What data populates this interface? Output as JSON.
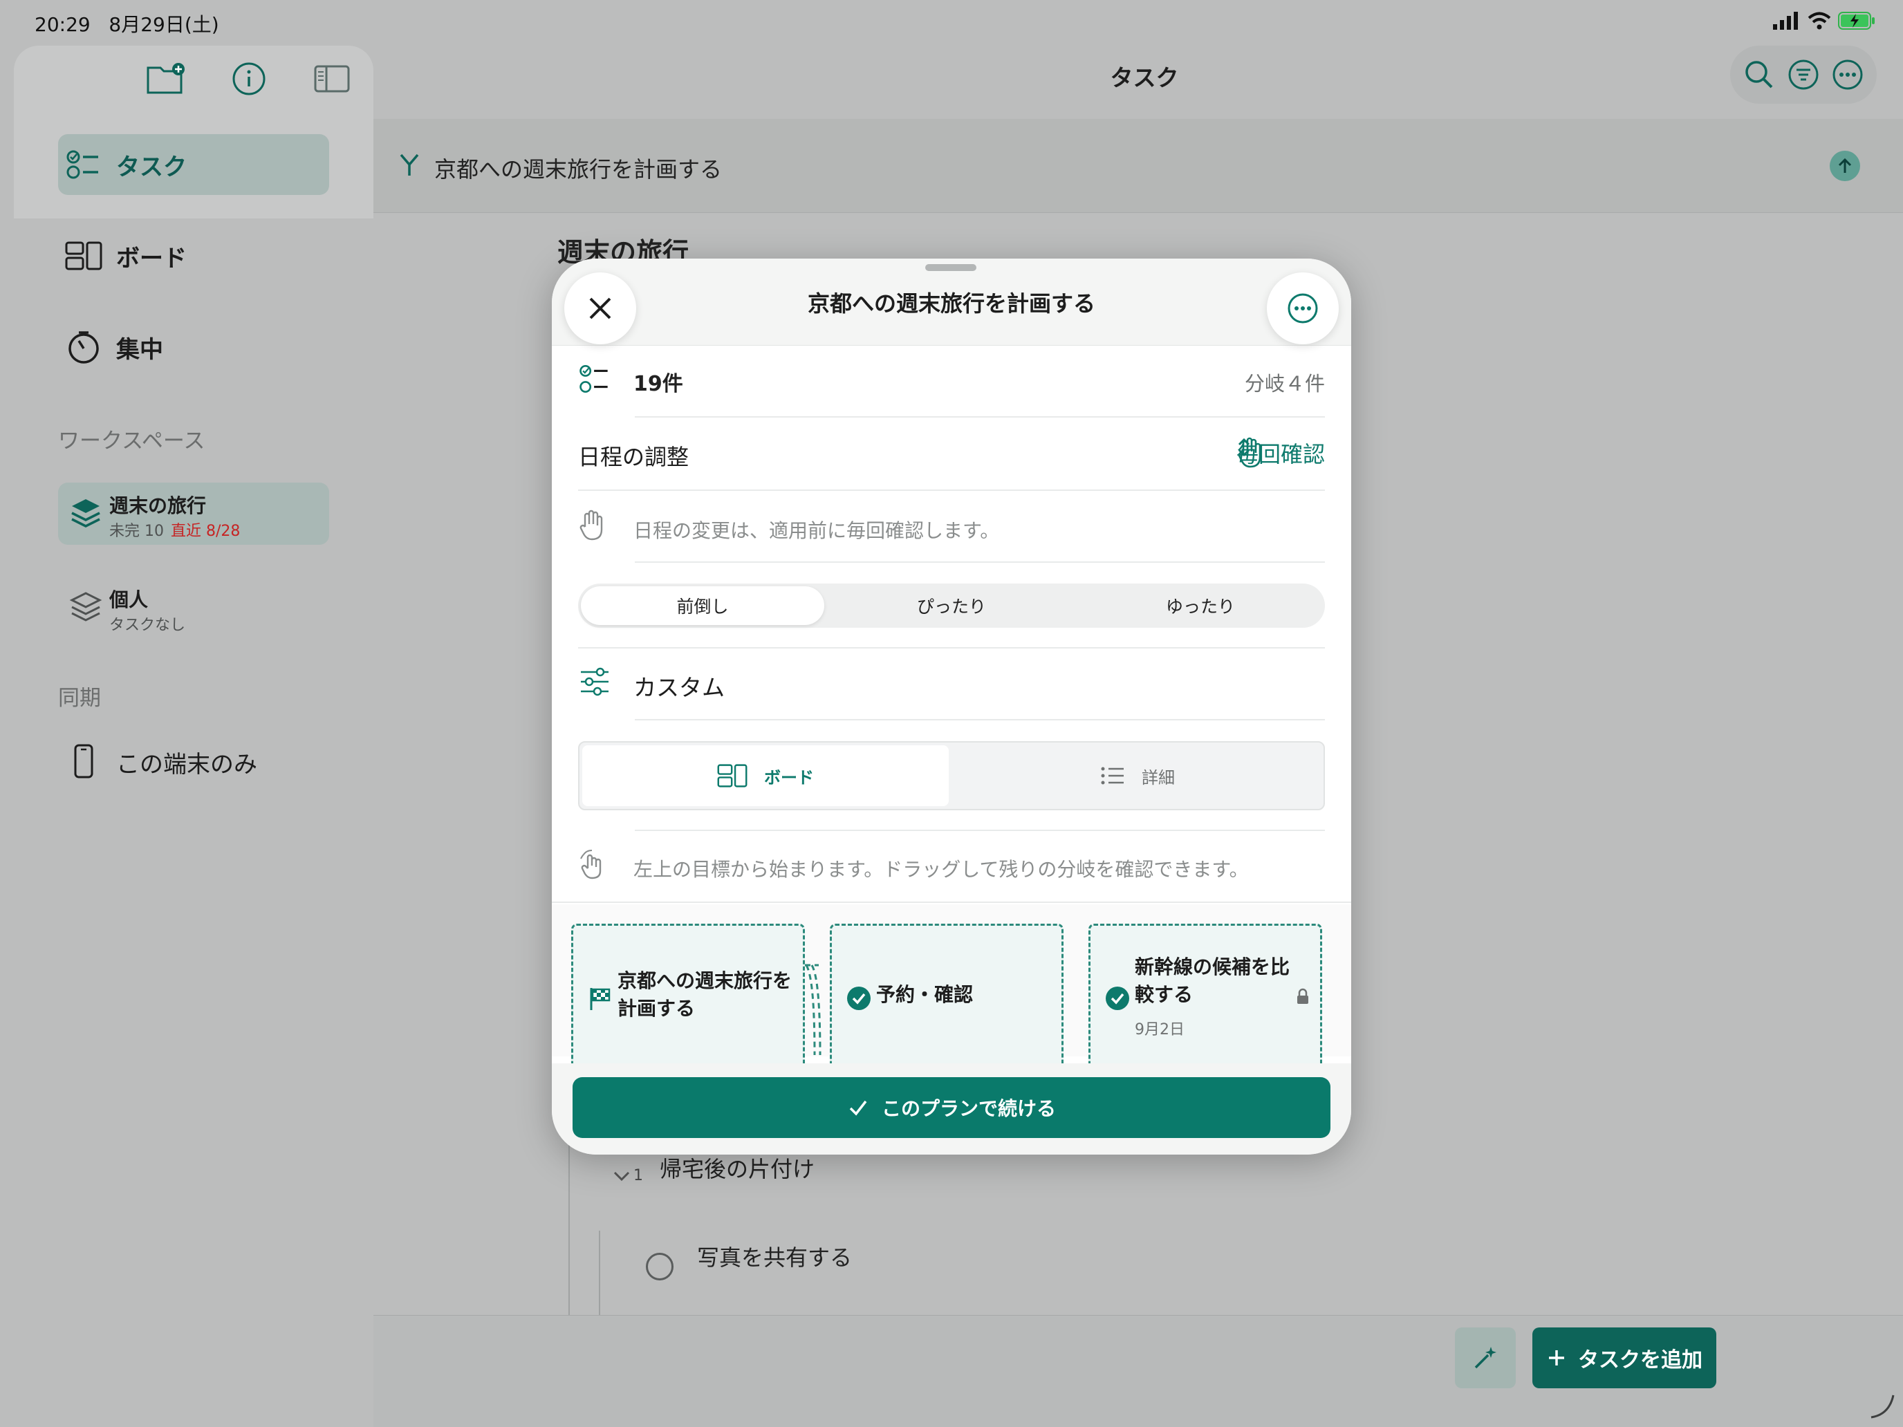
{
  "status_bar": {
    "time": "20:29",
    "date": "8月29日(土)"
  },
  "sidebar": {
    "nav": [
      {
        "label": "タスク",
        "icon": "checklist-icon",
        "active": true
      },
      {
        "label": "ボード",
        "icon": "board-icon",
        "active": false
      },
      {
        "label": "集中",
        "icon": "timer-icon",
        "active": false
      }
    ],
    "workspace_header": "ワークスペース",
    "workspaces": [
      {
        "name": "週末の旅行",
        "meta": "未完 10",
        "due": "直近 8/28",
        "active": true
      },
      {
        "name": "個人",
        "meta": "タスクなし",
        "due": "",
        "active": false
      }
    ],
    "sync_header": "同期",
    "sync_item": "この端末のみ"
  },
  "main": {
    "title": "タスク",
    "goal": "京都への週末旅行を計画する",
    "workspace_title": "週末の旅行",
    "group": {
      "count": "1",
      "label": "帰宅後の片付け"
    },
    "task": "写真を共有する",
    "add_task": "タスクを追加"
  },
  "modal": {
    "title": "京都への週末旅行を計画する",
    "count": "19件",
    "branches": "分岐４件",
    "schedule_label": "日程の調整",
    "confirm_mode": "毎回確認",
    "confirm_hint": "日程の変更は、適用前に毎回確認します。",
    "modes": [
      "前倒し",
      "ぴったり",
      "ゆったり"
    ],
    "custom_label": "カスタム",
    "views": [
      "ボード",
      "詳細"
    ],
    "board_hint": "左上の目標から始まります。ドラッグして残りの分岐を確認できます。",
    "cards": [
      {
        "title": "京都への週末旅行を計画する",
        "icon": "flag-icon",
        "date": ""
      },
      {
        "title": "予約・確認",
        "icon": "check-circle-icon",
        "date": ""
      },
      {
        "title": "新幹線の候補を比較する",
        "icon": "check-circle-icon",
        "date": "9月2日"
      }
    ],
    "continue_label": "このプランで続ける"
  },
  "colors": {
    "accent": "#0a7a6b",
    "due": "#c62424"
  }
}
